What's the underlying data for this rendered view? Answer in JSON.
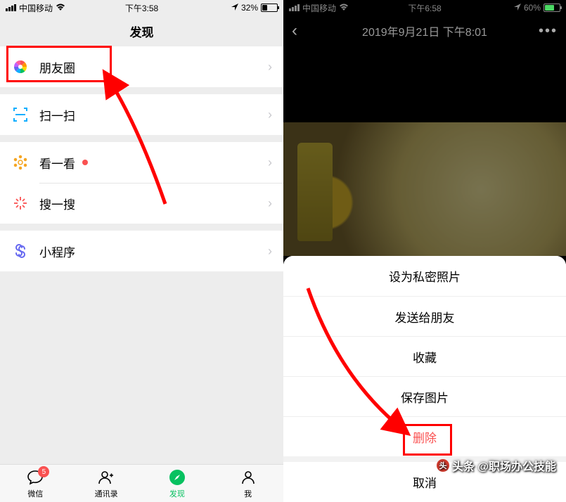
{
  "left": {
    "statusbar": {
      "carrier": "中国移动",
      "time": "下午3:58",
      "battery_pct": "32%"
    },
    "nav_title": "发现",
    "items": [
      {
        "label": "朋友圈"
      },
      {
        "label": "扫一扫"
      },
      {
        "label": "看一看",
        "dot": true
      },
      {
        "label": "搜一搜"
      },
      {
        "label": "小程序"
      }
    ],
    "tabs": [
      {
        "label": "微信",
        "badge": "5"
      },
      {
        "label": "通讯录"
      },
      {
        "label": "发现"
      },
      {
        "label": "我"
      }
    ]
  },
  "right": {
    "statusbar": {
      "carrier": "中国移动",
      "time": "下午6:58",
      "battery_pct": "60%"
    },
    "nav_title": "2019年9月21日 下午8:01",
    "sheet": {
      "items": [
        "设为私密照片",
        "发送给朋友",
        "收藏",
        "保存图片",
        "删除"
      ],
      "cancel": "取消"
    }
  },
  "watermark": "头条 @职场办公技能"
}
